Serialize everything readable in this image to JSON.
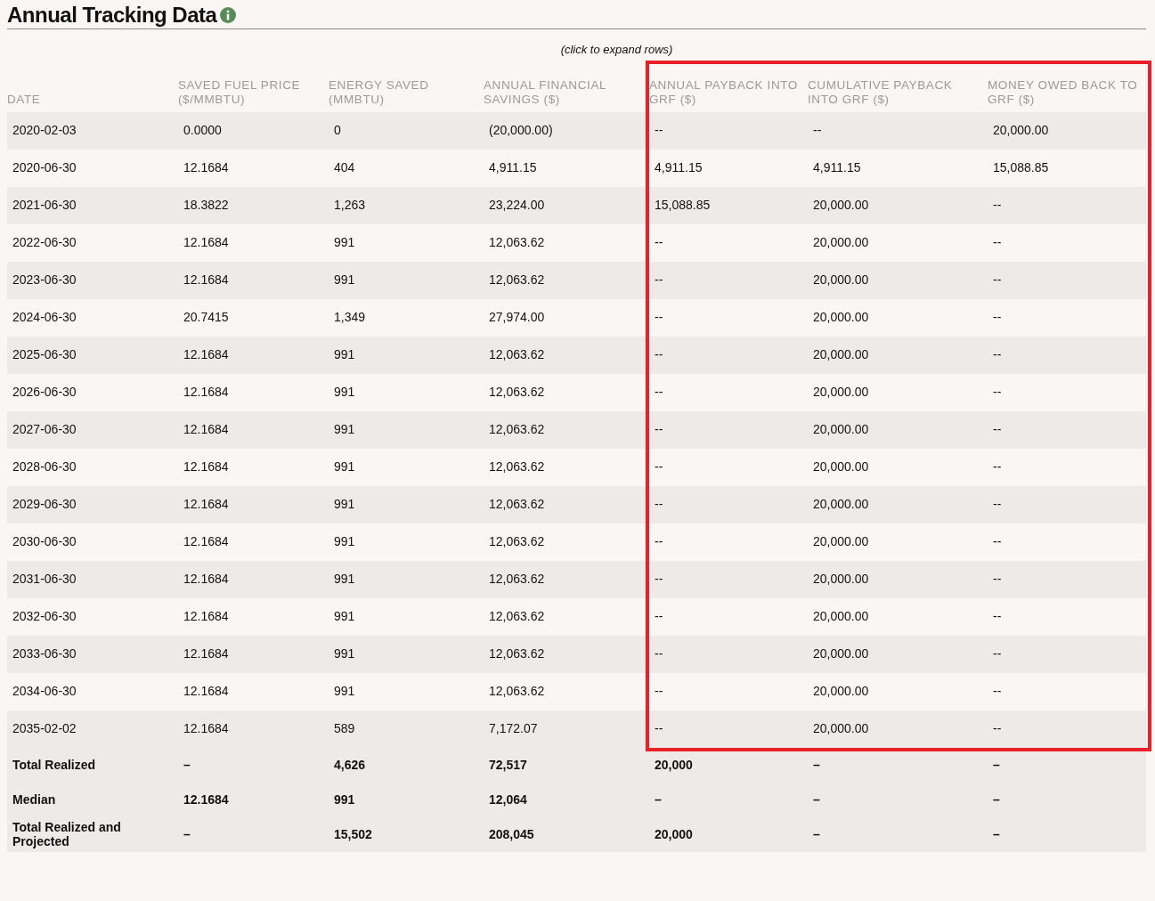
{
  "title": "Annual Tracking Data",
  "hint": "(click to expand rows)",
  "table": {
    "columns": [
      {
        "label": "DATE",
        "highlighted": false
      },
      {
        "label": "SAVED FUEL PRICE ($/MMBTU)",
        "highlighted": false
      },
      {
        "label": "ENERGY SAVED (MMBTU)",
        "highlighted": false
      },
      {
        "label": "ANNUAL FINANCIAL SAVINGS ($)",
        "highlighted": false
      },
      {
        "label": "ANNUAL PAYBACK INTO GRF ($)",
        "highlighted": true
      },
      {
        "label": "CUMULATIVE PAYBACK INTO GRF ($)",
        "highlighted": true
      },
      {
        "label": "MONEY OWED BACK TO GRF ($)",
        "highlighted": true
      }
    ],
    "rows": [
      [
        "2020-02-03",
        "0.0000",
        "0",
        "(20,000.00)",
        "--",
        "--",
        "20,000.00"
      ],
      [
        "2020-06-30",
        "12.1684",
        "404",
        "4,911.15",
        "4,911.15",
        "4,911.15",
        "15,088.85"
      ],
      [
        "2021-06-30",
        "18.3822",
        "1,263",
        "23,224.00",
        "15,088.85",
        "20,000.00",
        "--"
      ],
      [
        "2022-06-30",
        "12.1684",
        "991",
        "12,063.62",
        "--",
        "20,000.00",
        "--"
      ],
      [
        "2023-06-30",
        "12.1684",
        "991",
        "12,063.62",
        "--",
        "20,000.00",
        "--"
      ],
      [
        "2024-06-30",
        "20.7415",
        "1,349",
        "27,974.00",
        "--",
        "20,000.00",
        "--"
      ],
      [
        "2025-06-30",
        "12.1684",
        "991",
        "12,063.62",
        "--",
        "20,000.00",
        "--"
      ],
      [
        "2026-06-30",
        "12.1684",
        "991",
        "12,063.62",
        "--",
        "20,000.00",
        "--"
      ],
      [
        "2027-06-30",
        "12.1684",
        "991",
        "12,063.62",
        "--",
        "20,000.00",
        "--"
      ],
      [
        "2028-06-30",
        "12.1684",
        "991",
        "12,063.62",
        "--",
        "20,000.00",
        "--"
      ],
      [
        "2029-06-30",
        "12.1684",
        "991",
        "12,063.62",
        "--",
        "20,000.00",
        "--"
      ],
      [
        "2030-06-30",
        "12.1684",
        "991",
        "12,063.62",
        "--",
        "20,000.00",
        "--"
      ],
      [
        "2031-06-30",
        "12.1684",
        "991",
        "12,063.62",
        "--",
        "20,000.00",
        "--"
      ],
      [
        "2032-06-30",
        "12.1684",
        "991",
        "12,063.62",
        "--",
        "20,000.00",
        "--"
      ],
      [
        "2033-06-30",
        "12.1684",
        "991",
        "12,063.62",
        "--",
        "20,000.00",
        "--"
      ],
      [
        "2034-06-30",
        "12.1684",
        "991",
        "12,063.62",
        "--",
        "20,000.00",
        "--"
      ],
      [
        "2035-02-02",
        "12.1684",
        "589",
        "7,172.07",
        "--",
        "20,000.00",
        "--"
      ]
    ],
    "totals": [
      [
        "Total Realized",
        "–",
        "4,626",
        "72,517",
        "20,000",
        "–",
        "–"
      ],
      [
        "Median",
        "12.1684",
        "991",
        "12,064",
        "–",
        "–",
        "–"
      ],
      [
        "Total Realized and Projected",
        "–",
        "15,502",
        "208,045",
        "20,000",
        "–",
        "–"
      ]
    ]
  }
}
